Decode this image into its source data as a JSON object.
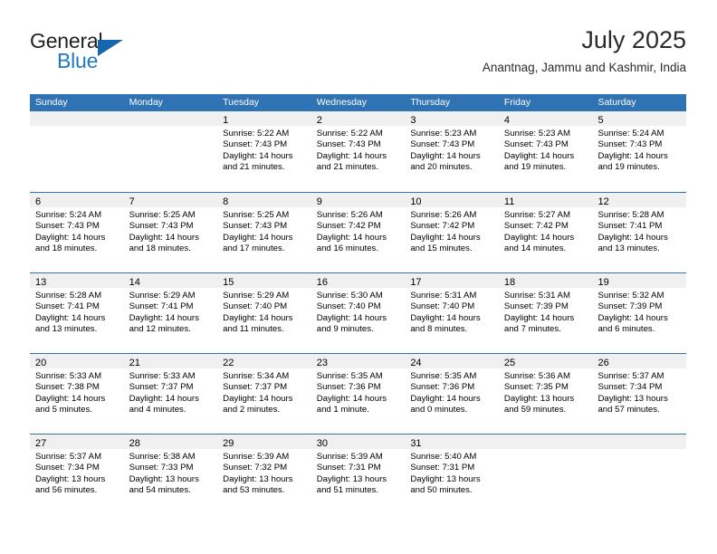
{
  "logo": {
    "word_one": "General",
    "word_two": "Blue",
    "triangle_icon": "triangle-icon"
  },
  "header": {
    "title": "July 2025",
    "subtitle": "Anantnag, Jammu and Kashmir, India"
  },
  "colors": {
    "header_blue": "#3073B5",
    "day_band_gray": "#F0F0F0",
    "logo_blue": "#1F78C1",
    "logo_triangle_blue": "#1566AD",
    "text": "#000000"
  },
  "weekday_headers": [
    "Sunday",
    "Monday",
    "Tuesday",
    "Wednesday",
    "Thursday",
    "Friday",
    "Saturday"
  ],
  "weeks": [
    [
      {
        "day": "",
        "lines": []
      },
      {
        "day": "",
        "lines": []
      },
      {
        "day": "1",
        "lines": [
          "Sunrise: 5:22 AM",
          "Sunset: 7:43 PM",
          "Daylight: 14 hours",
          "and 21 minutes."
        ]
      },
      {
        "day": "2",
        "lines": [
          "Sunrise: 5:22 AM",
          "Sunset: 7:43 PM",
          "Daylight: 14 hours",
          "and 21 minutes."
        ]
      },
      {
        "day": "3",
        "lines": [
          "Sunrise: 5:23 AM",
          "Sunset: 7:43 PM",
          "Daylight: 14 hours",
          "and 20 minutes."
        ]
      },
      {
        "day": "4",
        "lines": [
          "Sunrise: 5:23 AM",
          "Sunset: 7:43 PM",
          "Daylight: 14 hours",
          "and 19 minutes."
        ]
      },
      {
        "day": "5",
        "lines": [
          "Sunrise: 5:24 AM",
          "Sunset: 7:43 PM",
          "Daylight: 14 hours",
          "and 19 minutes."
        ]
      }
    ],
    [
      {
        "day": "6",
        "lines": [
          "Sunrise: 5:24 AM",
          "Sunset: 7:43 PM",
          "Daylight: 14 hours",
          "and 18 minutes."
        ]
      },
      {
        "day": "7",
        "lines": [
          "Sunrise: 5:25 AM",
          "Sunset: 7:43 PM",
          "Daylight: 14 hours",
          "and 18 minutes."
        ]
      },
      {
        "day": "8",
        "lines": [
          "Sunrise: 5:25 AM",
          "Sunset: 7:43 PM",
          "Daylight: 14 hours",
          "and 17 minutes."
        ]
      },
      {
        "day": "9",
        "lines": [
          "Sunrise: 5:26 AM",
          "Sunset: 7:42 PM",
          "Daylight: 14 hours",
          "and 16 minutes."
        ]
      },
      {
        "day": "10",
        "lines": [
          "Sunrise: 5:26 AM",
          "Sunset: 7:42 PM",
          "Daylight: 14 hours",
          "and 15 minutes."
        ]
      },
      {
        "day": "11",
        "lines": [
          "Sunrise: 5:27 AM",
          "Sunset: 7:42 PM",
          "Daylight: 14 hours",
          "and 14 minutes."
        ]
      },
      {
        "day": "12",
        "lines": [
          "Sunrise: 5:28 AM",
          "Sunset: 7:41 PM",
          "Daylight: 14 hours",
          "and 13 minutes."
        ]
      }
    ],
    [
      {
        "day": "13",
        "lines": [
          "Sunrise: 5:28 AM",
          "Sunset: 7:41 PM",
          "Daylight: 14 hours",
          "and 13 minutes."
        ]
      },
      {
        "day": "14",
        "lines": [
          "Sunrise: 5:29 AM",
          "Sunset: 7:41 PM",
          "Daylight: 14 hours",
          "and 12 minutes."
        ]
      },
      {
        "day": "15",
        "lines": [
          "Sunrise: 5:29 AM",
          "Sunset: 7:40 PM",
          "Daylight: 14 hours",
          "and 11 minutes."
        ]
      },
      {
        "day": "16",
        "lines": [
          "Sunrise: 5:30 AM",
          "Sunset: 7:40 PM",
          "Daylight: 14 hours",
          "and 9 minutes."
        ]
      },
      {
        "day": "17",
        "lines": [
          "Sunrise: 5:31 AM",
          "Sunset: 7:40 PM",
          "Daylight: 14 hours",
          "and 8 minutes."
        ]
      },
      {
        "day": "18",
        "lines": [
          "Sunrise: 5:31 AM",
          "Sunset: 7:39 PM",
          "Daylight: 14 hours",
          "and 7 minutes."
        ]
      },
      {
        "day": "19",
        "lines": [
          "Sunrise: 5:32 AM",
          "Sunset: 7:39 PM",
          "Daylight: 14 hours",
          "and 6 minutes."
        ]
      }
    ],
    [
      {
        "day": "20",
        "lines": [
          "Sunrise: 5:33 AM",
          "Sunset: 7:38 PM",
          "Daylight: 14 hours",
          "and 5 minutes."
        ]
      },
      {
        "day": "21",
        "lines": [
          "Sunrise: 5:33 AM",
          "Sunset: 7:37 PM",
          "Daylight: 14 hours",
          "and 4 minutes."
        ]
      },
      {
        "day": "22",
        "lines": [
          "Sunrise: 5:34 AM",
          "Sunset: 7:37 PM",
          "Daylight: 14 hours",
          "and 2 minutes."
        ]
      },
      {
        "day": "23",
        "lines": [
          "Sunrise: 5:35 AM",
          "Sunset: 7:36 PM",
          "Daylight: 14 hours",
          "and 1 minute."
        ]
      },
      {
        "day": "24",
        "lines": [
          "Sunrise: 5:35 AM",
          "Sunset: 7:36 PM",
          "Daylight: 14 hours",
          "and 0 minutes."
        ]
      },
      {
        "day": "25",
        "lines": [
          "Sunrise: 5:36 AM",
          "Sunset: 7:35 PM",
          "Daylight: 13 hours",
          "and 59 minutes."
        ]
      },
      {
        "day": "26",
        "lines": [
          "Sunrise: 5:37 AM",
          "Sunset: 7:34 PM",
          "Daylight: 13 hours",
          "and 57 minutes."
        ]
      }
    ],
    [
      {
        "day": "27",
        "lines": [
          "Sunrise: 5:37 AM",
          "Sunset: 7:34 PM",
          "Daylight: 13 hours",
          "and 56 minutes."
        ]
      },
      {
        "day": "28",
        "lines": [
          "Sunrise: 5:38 AM",
          "Sunset: 7:33 PM",
          "Daylight: 13 hours",
          "and 54 minutes."
        ]
      },
      {
        "day": "29",
        "lines": [
          "Sunrise: 5:39 AM",
          "Sunset: 7:32 PM",
          "Daylight: 13 hours",
          "and 53 minutes."
        ]
      },
      {
        "day": "30",
        "lines": [
          "Sunrise: 5:39 AM",
          "Sunset: 7:31 PM",
          "Daylight: 13 hours",
          "and 51 minutes."
        ]
      },
      {
        "day": "31",
        "lines": [
          "Sunrise: 5:40 AM",
          "Sunset: 7:31 PM",
          "Daylight: 13 hours",
          "and 50 minutes."
        ]
      },
      {
        "day": "",
        "lines": []
      },
      {
        "day": "",
        "lines": []
      }
    ]
  ]
}
